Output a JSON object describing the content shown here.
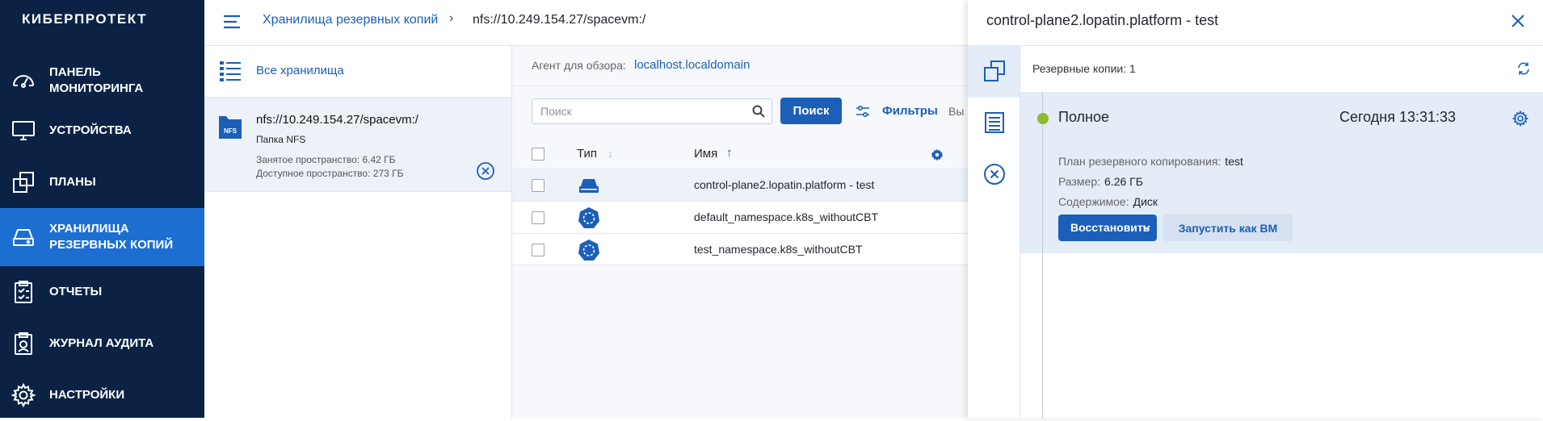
{
  "app": {
    "logo": "КИБЕРПРОТЕКТ"
  },
  "sidebar": {
    "items": [
      {
        "label": "Панель мониторинга",
        "icon": "dashboard-icon"
      },
      {
        "label": "Устройства",
        "icon": "monitor-icon"
      },
      {
        "label": "Планы",
        "icon": "plans-icon"
      },
      {
        "label": "Хранилища резервных копий",
        "icon": "storage-icon",
        "active": true
      },
      {
        "label": "Отчеты",
        "icon": "reports-icon"
      },
      {
        "label": "Журнал аудита",
        "icon": "audit-icon"
      },
      {
        "label": "Настройки",
        "icon": "gear-icon"
      }
    ]
  },
  "breadcrumb": {
    "storages": "Хранилища резервных копий",
    "separator": "›",
    "current": "nfs://10.249.154.27/spacevm:/"
  },
  "storage_panel": {
    "all_label": "Все хранилища",
    "item": {
      "badge": "NFS",
      "name": "nfs://10.249.154.27/spacevm:/",
      "type": "Папка NFS",
      "used": "Занятое пространство: 6.42 ГБ",
      "free": "Доступное пространство: 273 ГБ"
    }
  },
  "main": {
    "agent_label": "Агент для обзора:",
    "agent_value": "localhost.localdomain",
    "search_placeholder": "Поиск",
    "search_button": "Поиск",
    "filters_label": "Фильтры",
    "select_label": "Вы",
    "columns": {
      "type": "Тип",
      "name": "Имя"
    },
    "rows": [
      {
        "name": "control-plane2.lopatin.platform - test",
        "icon": "drive-icon",
        "selected": true
      },
      {
        "name": "default_namespace.k8s_withoutCBT",
        "icon": "kubernetes-icon"
      },
      {
        "name": "test_namespace.k8s_withoutCBT",
        "icon": "kubernetes-icon"
      }
    ]
  },
  "details": {
    "title": "control-plane2.lopatin.platform - test",
    "backups_count": "Резервные копии: 1",
    "backup": {
      "kind": "Полное",
      "time": "Сегодня 13:31:33",
      "status_color": "#8dbb2e",
      "plan_label": "План резервного копирования:",
      "plan_value": "test",
      "size_label": "Размер:",
      "size_value": "6.26 ГБ",
      "content_label": "Содержимое:",
      "content_value": "Диск",
      "restore_button": "Восстановить",
      "run_vm_button": "Запустить как ВМ"
    }
  },
  "colors": {
    "sidebar_bg": "#0b2245",
    "accent": "#1c5fb8",
    "active_nav": "#1c6fd1"
  }
}
